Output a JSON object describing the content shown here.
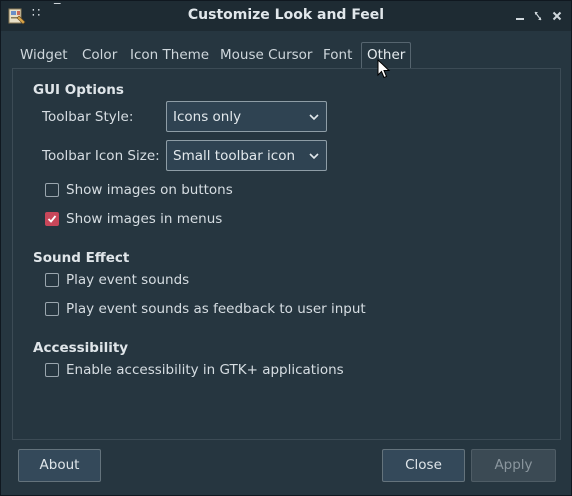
{
  "window": {
    "title": "Customize Look and Feel"
  },
  "tabs": [
    {
      "label": "Widget"
    },
    {
      "label": "Color"
    },
    {
      "label": "Icon Theme"
    },
    {
      "label": "Mouse Cursor"
    },
    {
      "label": "Font"
    },
    {
      "label": "Other",
      "active": true
    }
  ],
  "gui_options": {
    "title": "GUI Options",
    "toolbar_style_label": "Toolbar Style:",
    "toolbar_style_value": "Icons only",
    "toolbar_icon_size_label": "Toolbar Icon Size:",
    "toolbar_icon_size_value": "Small toolbar icon",
    "show_images_on_buttons": {
      "label": "Show images on buttons",
      "checked": false
    },
    "show_images_in_menus": {
      "label": "Show images in menus",
      "checked": true
    }
  },
  "sound_effect": {
    "title": "Sound Effect",
    "play_event_sounds": {
      "label": "Play event sounds",
      "checked": false
    },
    "play_feedback_sounds": {
      "label": "Play event sounds as feedback to user input",
      "checked": false
    }
  },
  "accessibility": {
    "title": "Accessibility",
    "enable_gtk": {
      "label": "Enable accessibility in GTK+ applications",
      "checked": false
    }
  },
  "buttons": {
    "about": "About",
    "close": "Close",
    "apply": "Apply"
  },
  "colors": {
    "check_accent": "#c8475a",
    "window_bg": "#263640",
    "titlebar_bg": "#1e2b33"
  }
}
